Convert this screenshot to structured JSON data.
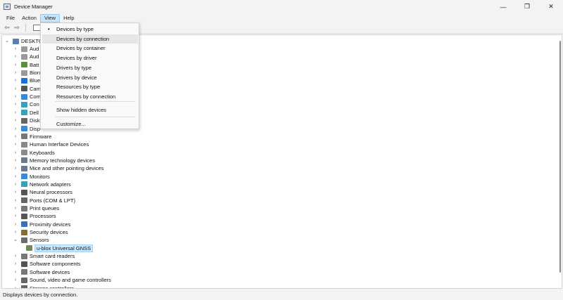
{
  "window": {
    "title": "Device Manager",
    "minimize": "—",
    "restore": "❐",
    "close": "✕"
  },
  "menubar": {
    "items": [
      "File",
      "Action",
      "View",
      "Help"
    ],
    "active": "View"
  },
  "toolbar": {
    "back": "⇦",
    "forward": "⇨"
  },
  "tree": {
    "root": "DESKTO",
    "rows": [
      {
        "label": "Aud",
        "expanded": false,
        "icon_color": "#9a9a9a",
        "clipped": true
      },
      {
        "label": "Aud",
        "expanded": false,
        "icon_color": "#9a9a9a",
        "clipped": true
      },
      {
        "label": "Batt",
        "expanded": false,
        "icon_color": "#5a8f3c",
        "clipped": true
      },
      {
        "label": "Bion",
        "expanded": false,
        "icon_color": "#9a9a9a",
        "clipped": true
      },
      {
        "label": "Blue",
        "expanded": false,
        "icon_color": "#1f6fd1",
        "clipped": true
      },
      {
        "label": "Cam",
        "expanded": false,
        "icon_color": "#555555",
        "clipped": true
      },
      {
        "label": "Com",
        "expanded": false,
        "icon_color": "#3b8ad8",
        "clipped": true
      },
      {
        "label": "Con",
        "expanded": false,
        "icon_color": "#3aa0b8",
        "clipped": true
      },
      {
        "label": "Dell",
        "expanded": false,
        "icon_color": "#3aa0b8",
        "clipped": true
      },
      {
        "label": "Disk",
        "expanded": false,
        "icon_color": "#666666",
        "clipped": true
      },
      {
        "label": "Disp",
        "expanded": false,
        "icon_color": "#3b8ad8",
        "clipped": true
      },
      {
        "label": "Firmware",
        "expanded": false,
        "icon_color": "#777777"
      },
      {
        "label": "Human Interface Devices",
        "expanded": false,
        "icon_color": "#888888"
      },
      {
        "label": "Keyboards",
        "expanded": false,
        "icon_color": "#8a8a8a"
      },
      {
        "label": "Memory technology devices",
        "expanded": false,
        "icon_color": "#6b7b8c"
      },
      {
        "label": "Mice and other pointing devices",
        "expanded": false,
        "icon_color": "#6b7b8c"
      },
      {
        "label": "Monitors",
        "expanded": false,
        "icon_color": "#3b8ad8"
      },
      {
        "label": "Network adapters",
        "expanded": false,
        "icon_color": "#3aa0b8"
      },
      {
        "label": "Neural processors",
        "expanded": false,
        "icon_color": "#555555"
      },
      {
        "label": "Ports (COM & LPT)",
        "expanded": false,
        "icon_color": "#666666"
      },
      {
        "label": "Print queues",
        "expanded": false,
        "icon_color": "#777777"
      },
      {
        "label": "Processors",
        "expanded": false,
        "icon_color": "#555555"
      },
      {
        "label": "Proximity devices",
        "expanded": false,
        "icon_color": "#3b6fb8"
      },
      {
        "label": "Security devices",
        "expanded": false,
        "icon_color": "#8a6a3a"
      },
      {
        "label": "Sensors",
        "expanded": true,
        "icon_color": "#6b6b6b"
      },
      {
        "label": "u-blox Universal GNSS",
        "child": true,
        "selected": true,
        "icon_color": "#6b8e4e"
      },
      {
        "label": "Smart card readers",
        "expanded": false,
        "icon_color": "#777777"
      },
      {
        "label": "Software components",
        "expanded": false,
        "icon_color": "#555555"
      },
      {
        "label": "Software devices",
        "expanded": false,
        "icon_color": "#777777"
      },
      {
        "label": "Sound, video and game controllers",
        "expanded": false,
        "icon_color": "#666666"
      },
      {
        "label": "Storage controllers",
        "expanded": false,
        "icon_color": "#666666"
      }
    ]
  },
  "view_menu": {
    "items": [
      {
        "label": "Devices by type",
        "checked": true
      },
      {
        "label": "Devices by connection",
        "hover": true
      },
      {
        "label": "Devices by container"
      },
      {
        "label": "Devices by driver"
      },
      {
        "label": "Drivers by type"
      },
      {
        "label": "Drivers by device"
      },
      {
        "label": "Resources by type"
      },
      {
        "label": "Resources by connection"
      }
    ],
    "show_hidden": "Show hidden devices",
    "customize": "Customize...",
    "check_glyph": "•"
  },
  "statusbar": {
    "text": "Displays devices by connection."
  }
}
